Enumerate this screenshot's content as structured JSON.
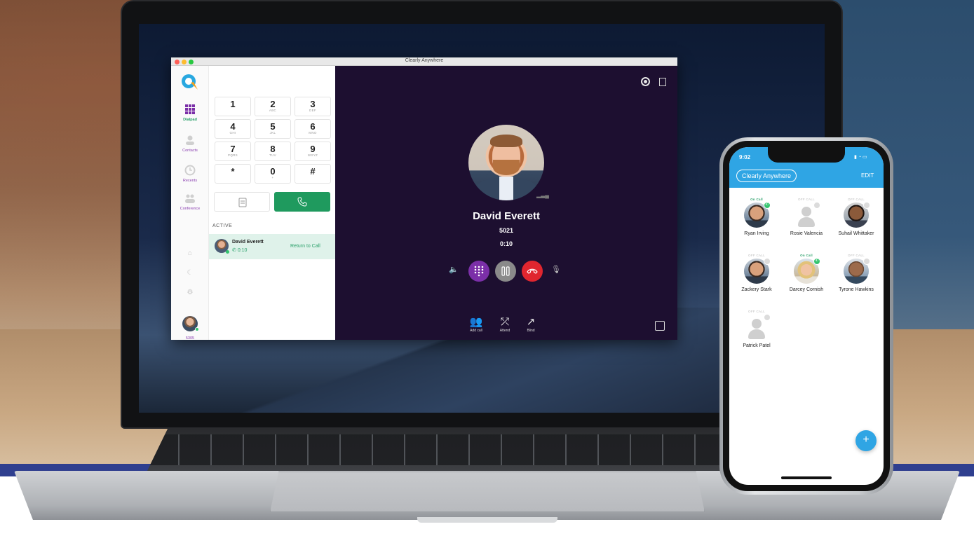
{
  "window": {
    "title": "Clearly Anywhere"
  },
  "sidebar": {
    "items": [
      {
        "label": "Dialpad",
        "icon": "dialpad-grid-icon",
        "active": true
      },
      {
        "label": "Contacts",
        "icon": "contact-person-icon"
      },
      {
        "label": "Recents",
        "icon": "clock-icon"
      },
      {
        "label": "Conference",
        "icon": "conference-people-icon"
      }
    ],
    "bottom_icons": [
      "home-icon",
      "moon-icon",
      "gear-icon"
    ],
    "user_ext": "5305"
  },
  "dialpad": {
    "keys": [
      {
        "num": "1",
        "letters": ""
      },
      {
        "num": "2",
        "letters": "ABC"
      },
      {
        "num": "3",
        "letters": "DEF"
      },
      {
        "num": "4",
        "letters": "GHI"
      },
      {
        "num": "5",
        "letters": "JKL"
      },
      {
        "num": "6",
        "letters": "MNO"
      },
      {
        "num": "7",
        "letters": "PQRS"
      },
      {
        "num": "8",
        "letters": "TUV"
      },
      {
        "num": "9",
        "letters": "WXYZ"
      },
      {
        "num": "*",
        "letters": ""
      },
      {
        "num": "0",
        "letters": "+"
      },
      {
        "num": "#",
        "letters": ""
      }
    ],
    "active_label": "ACTIVE",
    "active_call": {
      "name": "David Everett",
      "duration": "0:10",
      "action": "Return to Call"
    }
  },
  "call": {
    "name": "David Everett",
    "extension": "5021",
    "timer": "0:10",
    "actions": [
      {
        "label": "Add call",
        "icon": "add-call-icon"
      },
      {
        "label": "Attend",
        "icon": "attended-transfer-icon"
      },
      {
        "label": "Blind",
        "icon": "blind-transfer-icon"
      }
    ],
    "colors": {
      "keypad": "#7b2fa8",
      "hold": "#8a8a8a",
      "hangup": "#e0262f",
      "accent": "#1f9a5e"
    }
  },
  "phone": {
    "time": "9:02",
    "brand": "Clearly Anywhere",
    "edit": "EDIT",
    "contacts": [
      {
        "name": "Ryan Irving",
        "state": "On Call",
        "on_call": true
      },
      {
        "name": "Rosie Valencia",
        "state": "OFF CALL",
        "on_call": false
      },
      {
        "name": "Suhail Whittaker",
        "state": "OFF CALL",
        "on_call": false
      },
      {
        "name": "Zackery Stark",
        "state": "OFF CALL",
        "on_call": false
      },
      {
        "name": "Darcey Cornish",
        "state": "On Call",
        "on_call": true
      },
      {
        "name": "Tyrone Hawkins",
        "state": "OFF CALL",
        "on_call": false
      },
      {
        "name": "Patrick Patel",
        "state": "OFF CALL",
        "on_call": false
      }
    ],
    "fab": "+",
    "accent": "#2fa5e4"
  }
}
